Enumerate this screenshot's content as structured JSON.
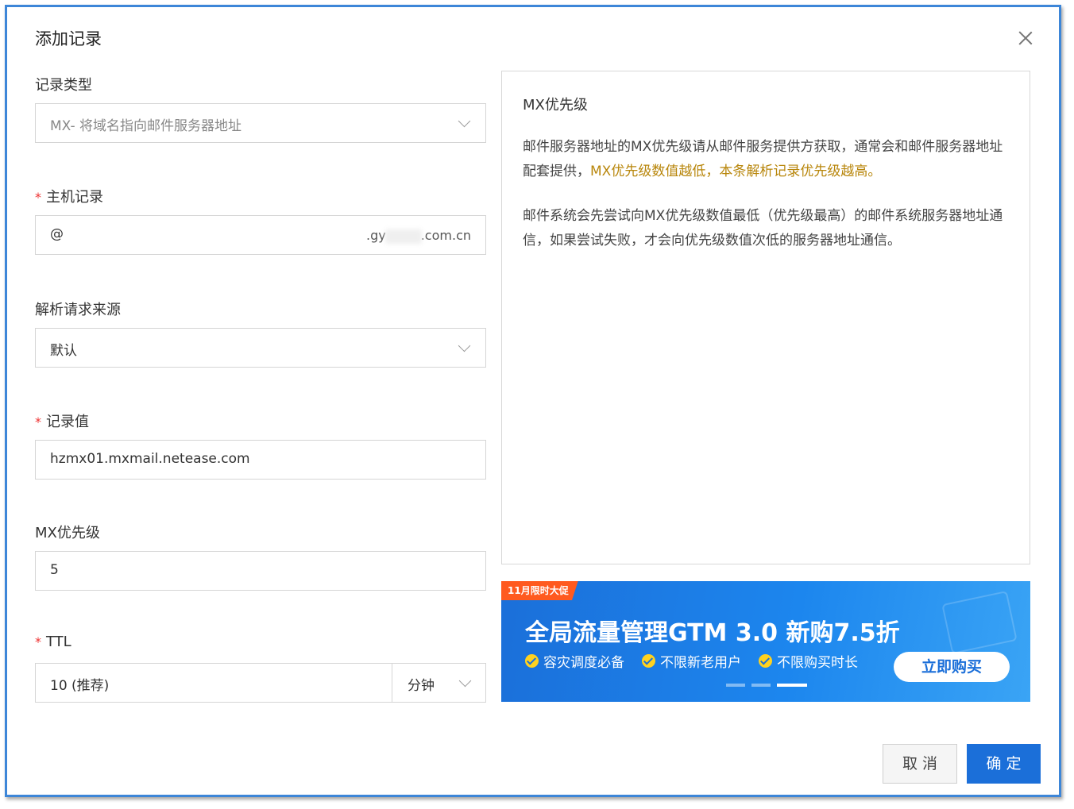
{
  "dialog": {
    "title": "添加记录",
    "close_icon": "close-icon"
  },
  "form": {
    "record_type": {
      "label": "记录类型",
      "value": "MX- 将域名指向邮件服务器地址"
    },
    "host": {
      "label": "主机记录",
      "value": "@",
      "domain_suffix_prefix": ".gy",
      "domain_suffix_end": ".com.cn"
    },
    "source": {
      "label": "解析请求来源",
      "value": "默认"
    },
    "record_value": {
      "label": "记录值",
      "value": "hzmx01.mxmail.netease.com"
    },
    "mx_priority": {
      "label": "MX优先级",
      "value": "5"
    },
    "ttl": {
      "label": "TTL",
      "value": "10 (推荐)",
      "unit": "分钟"
    },
    "required_mark": "*"
  },
  "info": {
    "title": "MX优先级",
    "para1_a": "邮件服务器地址的MX优先级请从邮件服务提供方获取，通常会和邮件服务器地址配套提供，",
    "para1_hl": "MX优先级数值越低，本条解析记录优先级越高。",
    "para2": "邮件系统会先尝试向MX优先级数值最低（优先级最高）的邮件系统服务器地址通信，如果尝试失败，才会向优先级数值次低的服务器地址通信。",
    "highlight_color": "#b8860b"
  },
  "banner": {
    "tag": "11月限时大促",
    "headline": "全局流量管理GTM 3.0 新购7.5折",
    "features": [
      "容灾调度必备",
      "不限新老用户",
      "不限购买时长"
    ],
    "cta": "立即购买",
    "slides": 3,
    "active_slide": 3,
    "color": "#1b6fd9"
  },
  "footer": {
    "cancel": "取 消",
    "ok": "确 定"
  }
}
